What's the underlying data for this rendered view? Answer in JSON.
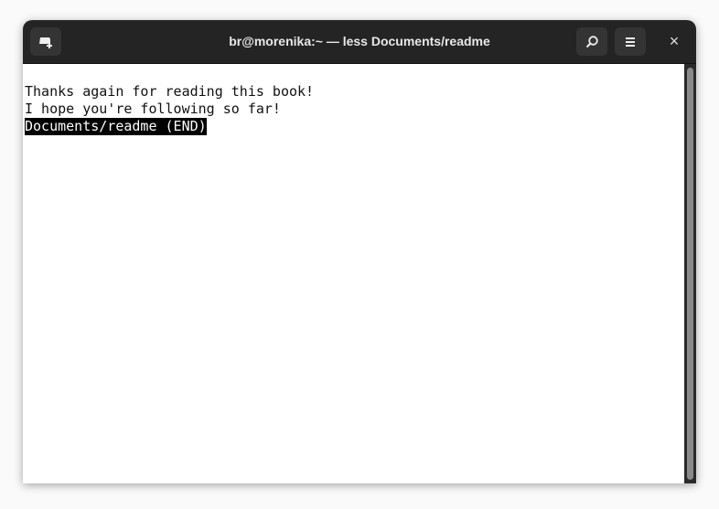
{
  "window": {
    "title": "br@morenika:~ — less Documents/readme"
  },
  "header": {
    "new_tab_icon": "new-tab-icon",
    "search_icon": "search-icon",
    "menu_icon": "hamburger-menu-icon",
    "close_icon": "close-icon",
    "close_glyph": "×"
  },
  "terminal": {
    "lines": [
      "Thanks again for reading this book!",
      "I hope you're following so far!"
    ],
    "status": "Documents/readme (END)"
  }
}
